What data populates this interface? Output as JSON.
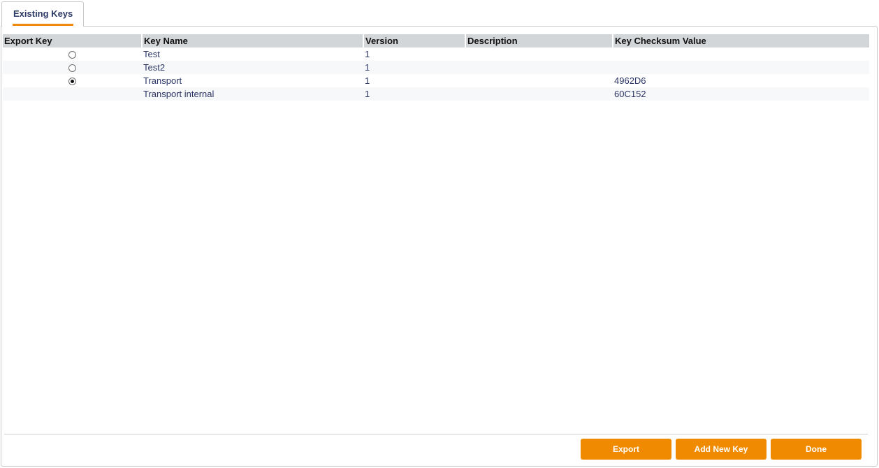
{
  "tab": {
    "label": "Existing Keys"
  },
  "table": {
    "columns": [
      "Export Key",
      "Key Name",
      "Version",
      "Description",
      "Key Checksum Value"
    ],
    "rows": [
      {
        "has_radio": true,
        "selected": false,
        "key_name": "Test",
        "version": "1",
        "description": "",
        "checksum": ""
      },
      {
        "has_radio": true,
        "selected": false,
        "key_name": "Test2",
        "version": "1",
        "description": "",
        "checksum": ""
      },
      {
        "has_radio": true,
        "selected": true,
        "key_name": "Transport",
        "version": "1",
        "description": "",
        "checksum": "4962D6"
      },
      {
        "has_radio": false,
        "selected": false,
        "key_name": "Transport internal",
        "version": "1",
        "description": "",
        "checksum": "60C152"
      }
    ]
  },
  "buttons": {
    "export": "Export",
    "add_new_key": "Add New Key",
    "done": "Done"
  },
  "colors": {
    "accent": "#f08a00",
    "header_bg": "#d2d6d9",
    "text": "#2b3566"
  }
}
